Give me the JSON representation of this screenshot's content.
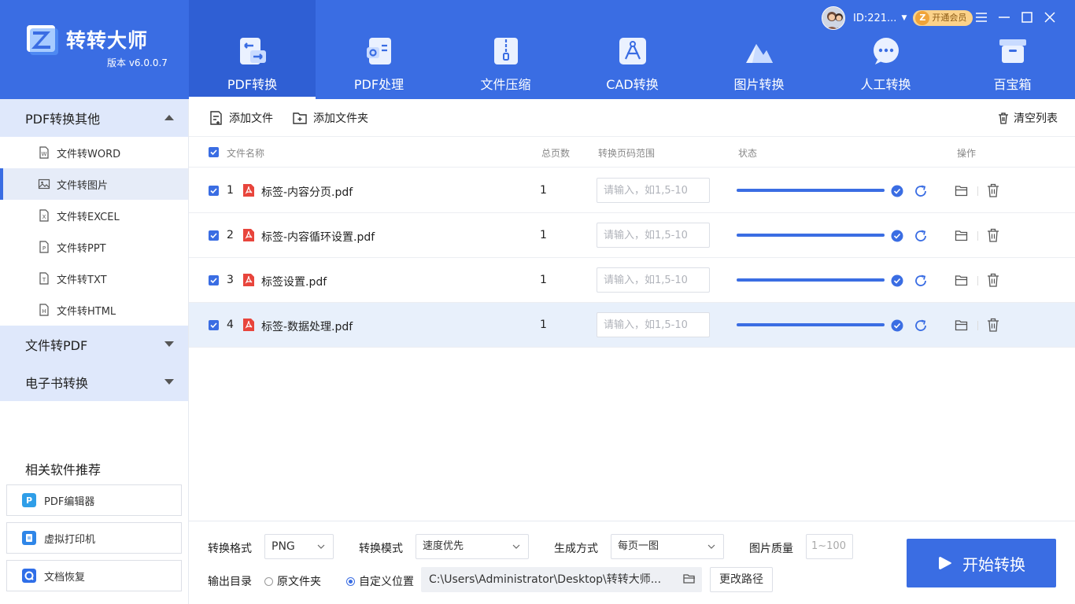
{
  "app": {
    "title": "转转大师",
    "version": "版本 v6.0.0.7"
  },
  "user": {
    "id": "ID:221...",
    "vip_label": "开通会员"
  },
  "nav": [
    {
      "label": "PDF转换",
      "icon": "pdf-convert-icon",
      "active": true
    },
    {
      "label": "PDF处理",
      "icon": "pdf-process-icon",
      "active": false
    },
    {
      "label": "文件压缩",
      "icon": "file-compress-icon",
      "active": false
    },
    {
      "label": "CAD转换",
      "icon": "cad-convert-icon",
      "active": false
    },
    {
      "label": "图片转换",
      "icon": "image-convert-icon",
      "active": false
    },
    {
      "label": "人工转换",
      "icon": "manual-convert-icon",
      "active": false
    },
    {
      "label": "百宝箱",
      "icon": "toolbox-icon",
      "active": false
    }
  ],
  "sidebar": {
    "groups": [
      {
        "label": "PDF转换其他",
        "expanded": true
      },
      {
        "label": "文件转PDF",
        "expanded": false
      },
      {
        "label": "电子书转换",
        "expanded": false
      }
    ],
    "items": [
      {
        "label": "文件转WORD",
        "icon": "word-file-icon",
        "active": false
      },
      {
        "label": "文件转图片",
        "icon": "image-file-icon",
        "active": true
      },
      {
        "label": "文件转EXCEL",
        "icon": "excel-file-icon",
        "active": false
      },
      {
        "label": "文件转PPT",
        "icon": "ppt-file-icon",
        "active": false
      },
      {
        "label": "文件转TXT",
        "icon": "txt-file-icon",
        "active": false
      },
      {
        "label": "文件转HTML",
        "icon": "html-file-icon",
        "active": false
      }
    ],
    "recommend_title": "相关软件推荐",
    "recommend": [
      {
        "label": "PDF编辑器",
        "color": "#2f9ee8"
      },
      {
        "label": "虚拟打印机",
        "color": "#2f86e8"
      },
      {
        "label": "文档恢复",
        "color": "#2f6ee8"
      }
    ]
  },
  "toolbar": {
    "add_file": "添加文件",
    "add_folder": "添加文件夹",
    "clear_list": "清空列表"
  },
  "table": {
    "headers": {
      "name": "文件名称",
      "pages": "总页数",
      "range": "转换页码范围",
      "status": "状态",
      "actions": "操作"
    },
    "range_placeholder": "请输入，如1,5-10",
    "rows": [
      {
        "index": "1",
        "name": "标签-内容分页.pdf",
        "pages": "1",
        "progress": 100,
        "highlighted": false
      },
      {
        "index": "2",
        "name": "标签-内容循环设置.pdf",
        "pages": "1",
        "progress": 100,
        "highlighted": false
      },
      {
        "index": "3",
        "name": "标签设置.pdf",
        "pages": "1",
        "progress": 100,
        "highlighted": false
      },
      {
        "index": "4",
        "name": "标签-数据处理.pdf",
        "pages": "1",
        "progress": 100,
        "highlighted": true
      }
    ]
  },
  "settings": {
    "format_label": "转换格式",
    "format_value": "PNG",
    "mode_label": "转换模式",
    "mode_value": "速度优先",
    "gen_label": "生成方式",
    "gen_value": "每页一图",
    "quality_label": "图片质量",
    "quality_placeholder": "1~100",
    "output_label": "输出目录",
    "radio_source": "原文件夹",
    "radio_custom": "自定义位置",
    "path": "C:\\Users\\Administrator\\Desktop\\转转大师...",
    "change_path": "更改路径",
    "start": "开始转换"
  },
  "colors": {
    "brand": "#3a6de3",
    "pdf_red": "#e8453c"
  }
}
